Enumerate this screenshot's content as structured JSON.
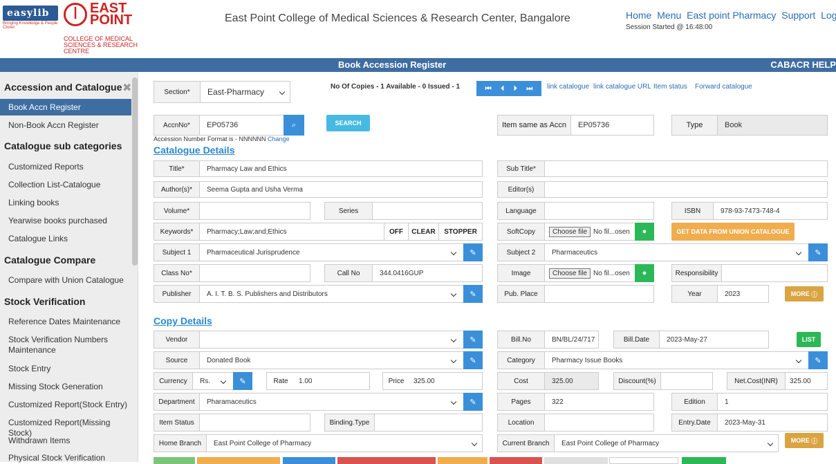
{
  "header": {
    "logo_easylib": "easylib",
    "logo_easylib_tagline": "Bringing Knowledge & People Closer",
    "logo_ep": "EAST POINT",
    "logo_college": "COLLEGE OF MEDICAL SCIENCES & RESEARCH CENTRE",
    "title": "East Point College of Medical Sciences & Research Center, Bangalore",
    "nav": [
      "Home",
      "Menu",
      "East point Pharmacy",
      "Support",
      "Logout"
    ],
    "session": "Session Started @ 16:48:00"
  },
  "bar": {
    "title": "Book Accession Register",
    "help": "CABACR HELP"
  },
  "sidebar": {
    "headings": [
      "Accession and Catalogue",
      "Catalogue sub categories",
      "Catalogue Compare",
      "Stock Verification"
    ],
    "active": "Book Accn Register",
    "items": [
      "Non-Book Accn Register",
      "Customized Reports",
      "Collection List-Catalogue",
      "Linking books",
      "Yearwise books purchased",
      "Catalogue Links",
      "Compare with Union Catalogue",
      "Reference Dates Maintenance",
      "Stock Verification Numbers Maintenance",
      "Stock Entry",
      "Missing Stock Generation",
      "Customized Report(Stock Entry)",
      "Customized Report(Missing Stock)",
      "Withdrawn Items",
      "Physical Stock Verification"
    ]
  },
  "top": {
    "section_label": "Section*",
    "section_value": "East-Pharmacy",
    "counts": "No Of Copies - 1   Available - 0   Issued - 1",
    "nav_icons": [
      "first-icon",
      "prev-icon",
      "next-icon",
      "last-icon"
    ],
    "links": [
      "link catalogue",
      "link catalogue URL",
      "Item status",
      "Forward catalogue"
    ],
    "accn_label": "AccnNo*",
    "accn_value": "EP05736",
    "search_btn": "SEARCH",
    "format_note": "Accession Number Format is - NNNNNN",
    "change": "Change",
    "same_label": "Item same as Accn",
    "same_value": "EP05736",
    "type_label": "Type",
    "type_value": "Book"
  },
  "catalogue": {
    "heading": "Catalogue Details",
    "title_label": "Title*",
    "title_value": "Pharmacy Law and Ethics",
    "subtitle_label": "Sub Title*",
    "author_label": "Author(s)*",
    "author_value": "Seema Gupta and Usha Verma",
    "editor_label": "Editor(s)",
    "volume_label": "Volume*",
    "series_label": "Series",
    "language_label": "Language",
    "isbn_label": "ISBN",
    "isbn_value": "978-93-7473-748-4",
    "keywords_label": "Keywords*",
    "keywords_value": "Pharmacy;Law;and;Ethics",
    "off": "OFF",
    "clear": "CLEAR",
    "stopper": "STOPPER",
    "softcopy_label": "SoftCopy",
    "choose_file": "Choose file",
    "no_file": "No fil...osen",
    "union_btn": "GET DATA FROM UNION CATALOGUE",
    "subject1_label": "Subject 1",
    "subject1_value": "Pharmaceutical Jurisprudence",
    "subject2_label": "Subject 2",
    "subject2_value": "Pharmaceutics",
    "classno_label": "Class No*",
    "callno_label": "Call No",
    "callno_value": "344.0416GUP",
    "image_label": "Image",
    "responsibility_label": "Responsibility",
    "publisher_label": "Publisher",
    "publisher_value": "A. I. T. B. S. Publishers and Distributors",
    "pubplace_label": "Pub. Place",
    "year_label": "Year",
    "year_value": "2023",
    "more": "MORE"
  },
  "copy": {
    "heading": "Copy Details",
    "vendor_label": "Vendor",
    "billno_label": "Bill.No",
    "billno_value": "BN/BL/24/717",
    "billdate_label": "Bill.Date",
    "billdate_value": "2023-May-27",
    "list_btn": "LIST",
    "source_label": "Source",
    "source_value": "Donated Book",
    "category_label": "Category",
    "category_value": "Pharmacy Issue Books",
    "currency_label": "Currency",
    "currency_value": "Rs.",
    "rate_label": "Rate",
    "rate_value": "1.00",
    "price_label": "Price",
    "price_value": "325.00",
    "cost_label": "Cost",
    "cost_value": "325.00",
    "discount_label": "Discount(%)",
    "netcost_label": "Net.Cost(INR)",
    "netcost_value": "325.00",
    "department_label": "Department",
    "department_value": "Pharamaceutics",
    "pages_label": "Pages",
    "pages_value": "322",
    "edition_label": "Edition",
    "edition_value": "1",
    "itemstatus_label": "Item Status",
    "binding_label": "Binding.Type",
    "location_label": "Location",
    "entrydate_label": "Entry.Date",
    "entrydate_value": "2023-May-31",
    "homebranch_label": "Home Branch",
    "homebranch_value": "East Point College of Pharmacy",
    "currentbranch_label": "Current Branch",
    "currentbranch_value": "East Point College of Pharmacy",
    "more": "MORE"
  },
  "colors": {
    "primary": "#3e6da2",
    "blue_btn": "#3b8fd9",
    "orange": "#f0ad4e",
    "green": "#2cb857",
    "gold": "#d9a441"
  }
}
